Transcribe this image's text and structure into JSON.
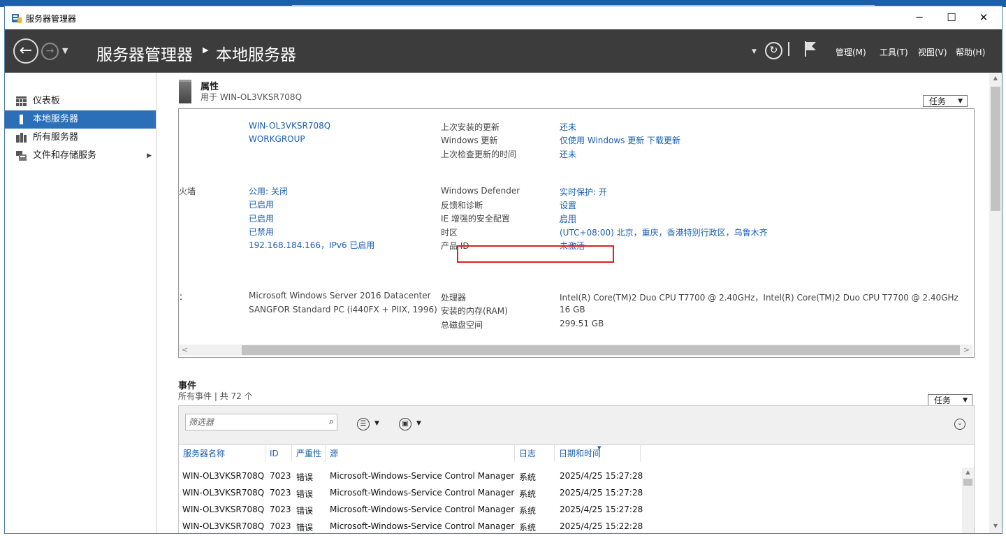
{
  "window": {
    "title": "服务器管理器"
  },
  "nav": {
    "breadcrumb_root": "服务器管理器",
    "breadcrumb_current": "本地服务器",
    "menus": [
      "管理(M)",
      "工具(T)",
      "视图(V)",
      "帮助(H)"
    ]
  },
  "sidebar": {
    "items": [
      {
        "label": "仪表板"
      },
      {
        "label": "本地服务器"
      },
      {
        "label": "所有服务器"
      },
      {
        "label": "文件和存储服务"
      }
    ]
  },
  "properties": {
    "title": "属性",
    "subtitle": "用于 WIN-OL3VKSR708Q",
    "task_label": "任务",
    "left_values": {
      "computer_name": "WIN-OL3VKSR708Q",
      "workgroup": "WORKGROUP",
      "firewall_label_partial": "火墙",
      "firewall": "公用: 关闭",
      "remote_mgmt": "已启用",
      "remote_desktop": "已启用",
      "nic_teaming": "已禁用",
      "ethernet": "192.168.184.166，IPv6 已启用",
      "os_label_partial": "：",
      "os": "Microsoft Windows Server 2016 Datacenter",
      "hardware": "SANGFOR Standard PC (i440FX + PIIX, 1996)"
    },
    "right_rows": [
      {
        "label": "上次安装的更新",
        "value": "还未"
      },
      {
        "label": "Windows 更新",
        "value": "仅使用 Windows 更新 下载更新"
      },
      {
        "label": "上次检查更新的时间",
        "value": "还未"
      },
      {
        "label": "Windows Defender",
        "value": "实时保护: 开"
      },
      {
        "label": "反馈和诊断",
        "value": "设置"
      },
      {
        "label": "IE 增强的安全配置",
        "value": "启用"
      },
      {
        "label": "时区",
        "value": "(UTC+08:00) 北京，重庆，香港特别行政区，乌鲁木齐"
      },
      {
        "label": "产品 ID",
        "value": "未激活"
      },
      {
        "label": "处理器",
        "value": "Intel(R) Core(TM)2 Duo CPU     T7700  @ 2.40GHz，Intel(R) Core(TM)2 Duo CPU     T7700  @ 2.40GHz"
      },
      {
        "label": "安装的内存(RAM)",
        "value": "16 GB"
      },
      {
        "label": "总磁盘空间",
        "value": "299.51 GB"
      }
    ]
  },
  "events": {
    "title": "事件",
    "subtitle": "所有事件 | 共 72 个",
    "task_label": "任务",
    "filter_placeholder": "筛选器",
    "columns": [
      "服务器名称",
      "ID",
      "严重性",
      "源",
      "日志",
      "日期和时间"
    ],
    "rows": [
      {
        "server": "WIN-OL3VKSR708Q",
        "id": "7023",
        "severity": "错误",
        "source": "Microsoft-Windows-Service Control Manager",
        "log": "系统",
        "datetime": "2025/4/25 15:27:28"
      },
      {
        "server": "WIN-OL3VKSR708Q",
        "id": "7023",
        "severity": "错误",
        "source": "Microsoft-Windows-Service Control Manager",
        "log": "系统",
        "datetime": "2025/4/25 15:27:28"
      },
      {
        "server": "WIN-OL3VKSR708Q",
        "id": "7023",
        "severity": "错误",
        "source": "Microsoft-Windows-Service Control Manager",
        "log": "系统",
        "datetime": "2025/4/25 15:27:28"
      },
      {
        "server": "WIN-OL3VKSR708Q",
        "id": "7023",
        "severity": "错误",
        "source": "Microsoft-Windows-Service Control Manager",
        "log": "系统",
        "datetime": "2025/4/25 15:22:28"
      }
    ]
  },
  "colors": {
    "accent": "#2a6fb8",
    "link": "#1a5fb4",
    "navbar": "#3c3c3c",
    "highlight": "#e02020"
  }
}
